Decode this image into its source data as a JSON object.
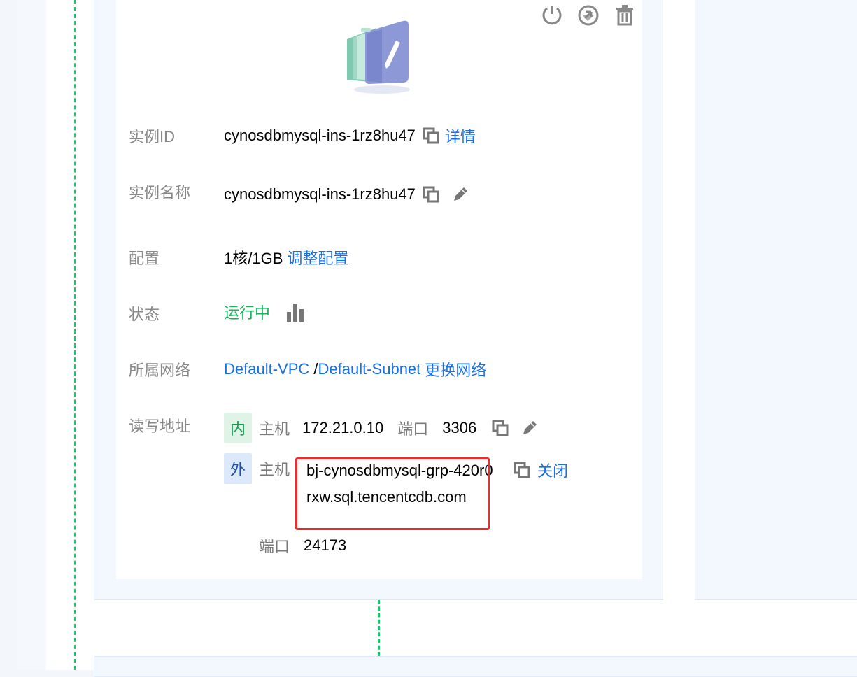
{
  "actions": {
    "power_icon": "power-icon",
    "reset_icon": "reset-icon",
    "delete_icon": "trash-icon"
  },
  "instance": {
    "id_label": "实例ID",
    "id_value": "cynosdbmysql-ins-1rz8hu47",
    "details_link": "详情",
    "name_label": "实例名称",
    "name_value": "cynosdbmysql-ins-1rz8hu47",
    "config_label": "配置",
    "config_value": "1核/1GB",
    "config_link": "调整配置",
    "status_label": "状态",
    "status_value": "运行中",
    "network_label": "所属网络",
    "vpc_link": "Default-VPC",
    "network_sep": " /",
    "subnet_link": "Default-Subnet",
    "change_network_link": "更换网络",
    "rw_label": "读写地址"
  },
  "internal": {
    "tag": "内",
    "host_label": "主机",
    "host_value": "172.21.0.10",
    "port_label": "端口",
    "port_value": "3306"
  },
  "external": {
    "tag": "外",
    "host_label": "主机",
    "host_value": "bj-cynosdbmysql-grp-420r0rxw.sql.tencentcdb.com",
    "close_link": "关闭",
    "port_label": "端口",
    "port_value": "24173"
  },
  "colors": {
    "link": "#1a6fe5",
    "status_running": "#1ab35c",
    "highlight_box": "#e53030",
    "connector": "#1ec36d"
  }
}
